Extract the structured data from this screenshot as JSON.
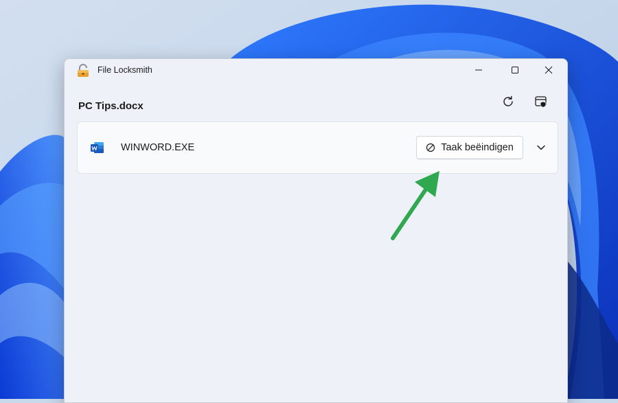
{
  "window": {
    "title": "File Locksmith",
    "app_icon": "padlock-open-icon",
    "controls": [
      "minimize-icon",
      "maximize-icon",
      "close-icon"
    ]
  },
  "header": {
    "file_name": "PC Tips.docx",
    "actions": [
      "refresh-icon",
      "admin-restart-icon"
    ]
  },
  "processes": [
    {
      "name": "WINWORD.EXE",
      "icon": "word-icon",
      "end_task_label": "Taak beëindigen",
      "end_task_icon": "block-icon",
      "expand_icon": "chevron-down-icon"
    }
  ],
  "colors": {
    "annotation_arrow": "#2fa84f",
    "word_blue": "#185abd",
    "lock_orange": "#e8a030"
  }
}
